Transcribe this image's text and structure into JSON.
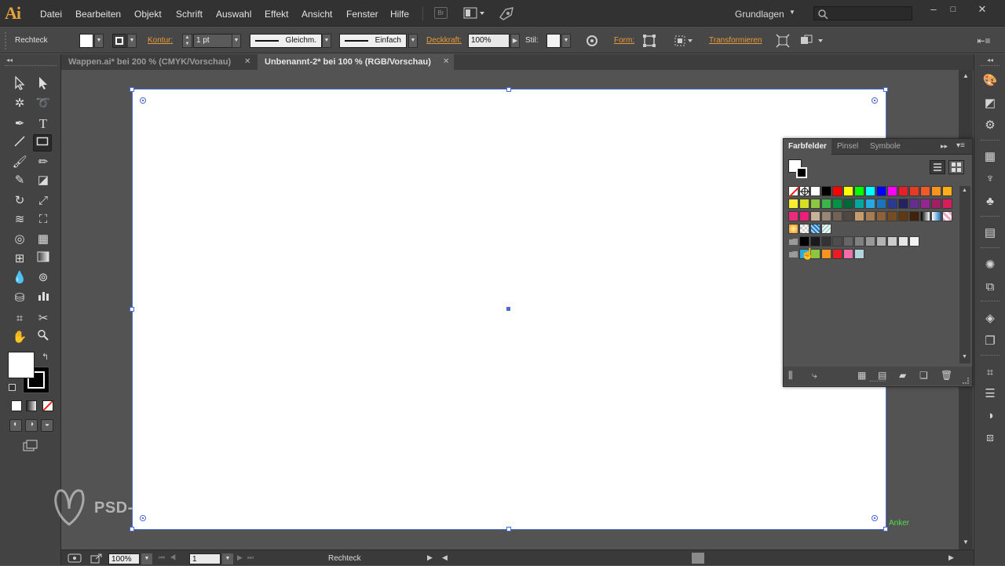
{
  "app": {
    "logo": "Ai"
  },
  "menu": [
    "Datei",
    "Bearbeiten",
    "Objekt",
    "Schrift",
    "Auswahl",
    "Effekt",
    "Ansicht",
    "Fenster",
    "Hilfe"
  ],
  "bridge_label": "Br",
  "workspace": "Grundlagen",
  "window_controls": [
    "–",
    "□",
    "✕"
  ],
  "control": {
    "object_label": "Rechteck",
    "kontur_label": "Kontur:",
    "stroke_weight": "1 pt",
    "profile": "Gleichm.",
    "brush": "Einfach",
    "opacity_label": "Deckkraft:",
    "opacity": "100%",
    "style_label": "Stil:",
    "form_label": "Form:",
    "transform_label": "Transformieren"
  },
  "tabs": [
    {
      "label": "Wappen.ai* bei 200 % (CMYK/Vorschau)",
      "active": false
    },
    {
      "label": "Unbenannt-2* bei 100 % (RGB/Vorschau)",
      "active": true
    }
  ],
  "tab_close": "✕",
  "canvas": {
    "anchor_hint": "Anker",
    "watermark": "PSD-tutorials.de"
  },
  "status": {
    "zoom": "100%",
    "page": "1",
    "tool_name": "Rechteck"
  },
  "swatches_panel": {
    "tabs": [
      "Farbfelder",
      "Pinsel",
      "Symbole"
    ],
    "active_tab": "Farbfelder",
    "rows": [
      [
        "none",
        "reg",
        "#ffffff",
        "#000000",
        "#ff0000",
        "#ffff00",
        "#00ff00",
        "#00ffff",
        "#0000ff",
        "#ff00ff",
        "#e6202a",
        "#e43a26",
        "#f05a24",
        "#f7941d",
        "#fbae17"
      ],
      [
        "#f9ed32",
        "#d7df23",
        "#8dc63f",
        "#39b54a",
        "#009444",
        "#006838",
        "#00a99d",
        "#27aae1",
        "#1c75bc",
        "#2b3990",
        "#262262",
        "#662d91",
        "#92278f",
        "#9e1f63",
        "#da1c5c"
      ],
      [
        "#ee2a7b",
        "#ed1e79",
        "#c7b299",
        "#998675",
        "#736357",
        "#534741",
        "#c69c6d",
        "#a67c52",
        "#8c6239",
        "#754c24",
        "#603813",
        "#42210b",
        "gradient_gray",
        "gradient_blue",
        "pattern_pink"
      ],
      [
        "gradient_orange",
        "pattern_checker",
        "pattern_blue",
        "pattern_teal"
      ],
      [
        "folder",
        "#000000",
        "#1a1a1a",
        "#333333",
        "#4d4d4d",
        "#666666",
        "#808080",
        "#999999",
        "#b3b3b3",
        "#cccccc",
        "#e6e6e6",
        "#f2f2f2"
      ],
      [
        "folder",
        "#29abe2",
        "#8cc63f",
        "#f7931e",
        "#ed1c24",
        "#f06eaa",
        "#b3d4dc"
      ]
    ]
  }
}
